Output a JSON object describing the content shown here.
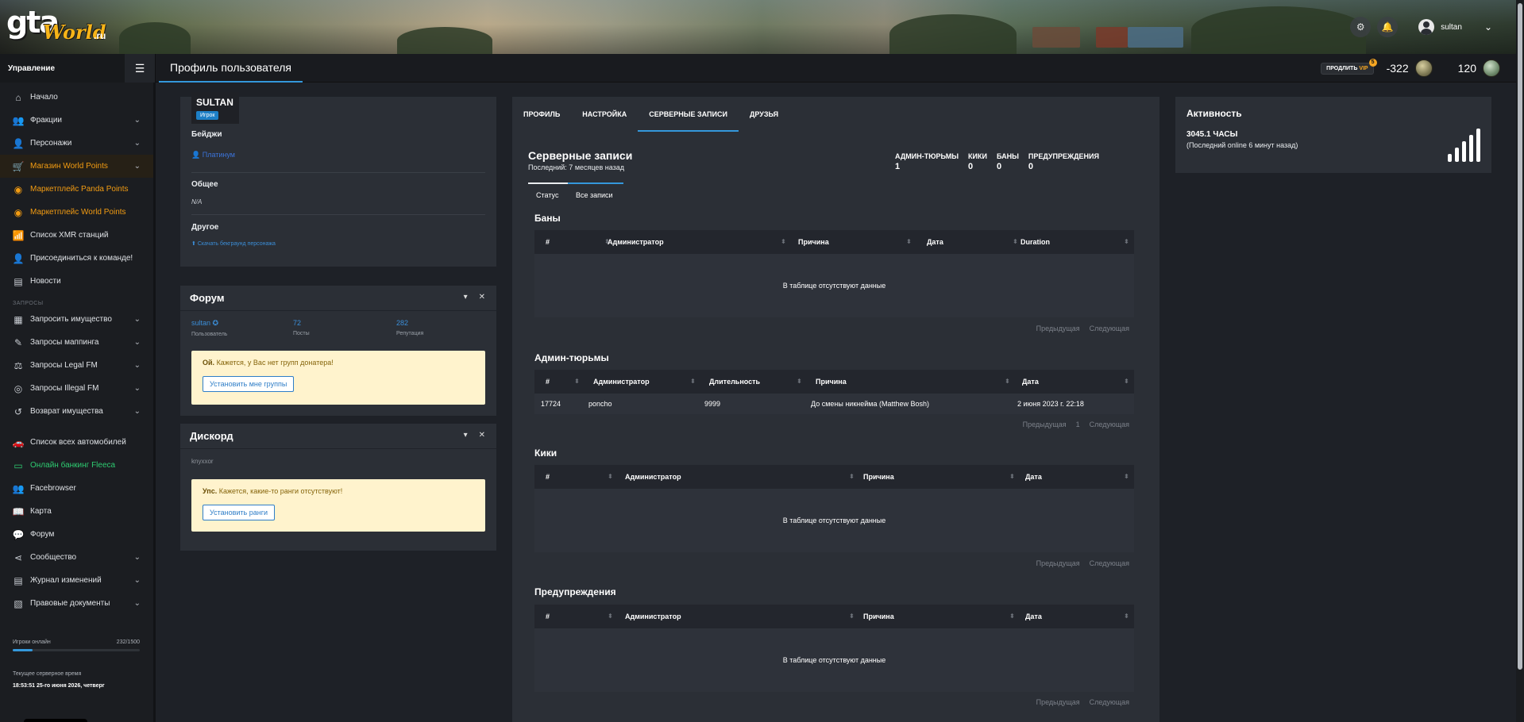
{
  "brand": {
    "logo_main": "gta",
    "logo_world": "World",
    "logo_tld": ".ru"
  },
  "header": {
    "username": "sultan"
  },
  "topbar": {
    "side_title": "Управление",
    "page_title": "Профиль пользователя",
    "vip_prefix": "ПРОДЛИТЬ",
    "vip_label": "VIP",
    "vip_badge": "5",
    "balance_1": "-322",
    "balance_2": "120"
  },
  "sidebar": {
    "items": [
      {
        "label": "Начало",
        "icon": "home-icon"
      },
      {
        "label": "Фракции",
        "icon": "users-icon"
      },
      {
        "label": "Персонажи",
        "icon": "user-icon"
      },
      {
        "label": "Магазин World Points",
        "icon": "cart-icon"
      },
      {
        "label": "Маркетплейс Panda Points",
        "icon": "coins-icon"
      },
      {
        "label": "Маркетплейс World Points",
        "icon": "coins-icon"
      },
      {
        "label": "Список XMR станций",
        "icon": "tower-icon"
      },
      {
        "label": "Присоединиться к команде!",
        "icon": "user-plus-icon"
      },
      {
        "label": "Новости",
        "icon": "newspaper-icon"
      }
    ],
    "requests_label": "ЗАПРОСЫ",
    "requests": [
      {
        "label": "Запросить имущество",
        "icon": "building-icon"
      },
      {
        "label": "Запросы маппинга",
        "icon": "brush-icon"
      },
      {
        "label": "Запросы Legal FM",
        "icon": "scale-icon"
      },
      {
        "label": "Запросы Illegal FM",
        "icon": "mask-icon"
      },
      {
        "label": "Возврат имущества",
        "icon": "undo-icon"
      }
    ],
    "bottom": [
      {
        "label": "Список всех автомобилей",
        "icon": "car-icon"
      },
      {
        "label": "Онлайн банкинг Fleeca",
        "icon": "bank-icon"
      },
      {
        "label": "Facebrowser",
        "icon": "users-icon"
      },
      {
        "label": "Карта",
        "icon": "map-icon"
      },
      {
        "label": "Форум",
        "icon": "comments-icon"
      },
      {
        "label": "Сообщество",
        "icon": "share-icon"
      },
      {
        "label": "Журнал изменений",
        "icon": "list-icon"
      },
      {
        "label": "Правовые документы",
        "icon": "docs-icon"
      }
    ],
    "online_label": "Игроки онлайн",
    "online_value": "232/1500",
    "online_fraction": 0.155,
    "time_label": "Текущее серверное время",
    "time_value": "18:53:51 25-го июня 2026, четверг"
  },
  "profile": {
    "name": "SULTAN",
    "role": "Игрок",
    "badges_title": "Бейджи",
    "badge": "Платинум",
    "general_title": "Общее",
    "general_value": "N/A",
    "other_title": "Другое",
    "download_link": "Скачать бекграунд персонажа"
  },
  "forum": {
    "title": "Форум",
    "user": "sultan",
    "user_label": "Пользователь",
    "posts": "72",
    "posts_label": "Посты",
    "rep": "282",
    "rep_label": "Репутация",
    "alert_bold": "Ой.",
    "alert_text": "Кажется, у Вас нет групп донатера!",
    "alert_button": "Установить мне группы"
  },
  "discord": {
    "title": "Дискорд",
    "user": "knyxxor",
    "alert_bold": "Упс.",
    "alert_text": "Кажется, какие-то ранги отсутствуют!",
    "alert_button": "Установить ранги"
  },
  "tabs": [
    "ПРОФИЛЬ",
    "НАСТРОЙКА",
    "СЕРВЕРНЫЕ ЗАПИСИ",
    "ДРУЗЬЯ"
  ],
  "records": {
    "title": "Серверные записи",
    "last": "Последний: 7 месяцев назад",
    "counters": [
      {
        "label": "АДМИН-ТЮРЬМЫ",
        "value": "1"
      },
      {
        "label": "КИКИ",
        "value": "0"
      },
      {
        "label": "БАНЫ",
        "value": "0"
      },
      {
        "label": "ПРЕДУПРЕЖДЕНИЯ",
        "value": "0"
      }
    ],
    "subtabs": [
      "Статус",
      "Все записи"
    ],
    "empty_text": "В таблице отсутствуют данные",
    "prev": "Предыдущая",
    "next": "Следующая",
    "page": "1",
    "bans": {
      "title": "Баны",
      "columns": [
        "#",
        "Администратор",
        "Причина",
        "Дата",
        "Duration"
      ]
    },
    "jails": {
      "title": "Админ-тюрьмы",
      "columns": [
        "#",
        "Администратор",
        "Длительность",
        "Причина",
        "Дата"
      ],
      "rows": [
        [
          "17724",
          "poncho",
          "9999",
          "До смены никнейма (Matthew Bosh)",
          "2 июня 2023 г. 22:18"
        ]
      ]
    },
    "kicks": {
      "title": "Кики",
      "columns": [
        "#",
        "Администратор",
        "Причина",
        "Дата"
      ]
    },
    "warns": {
      "title": "Предупреждения",
      "columns": [
        "#",
        "Администратор",
        "Причина",
        "Дата"
      ]
    }
  },
  "activity": {
    "title": "Активность",
    "hours": "3045.1 ЧАСЫ",
    "last_online": "(Последний online 6 минут назад)"
  }
}
